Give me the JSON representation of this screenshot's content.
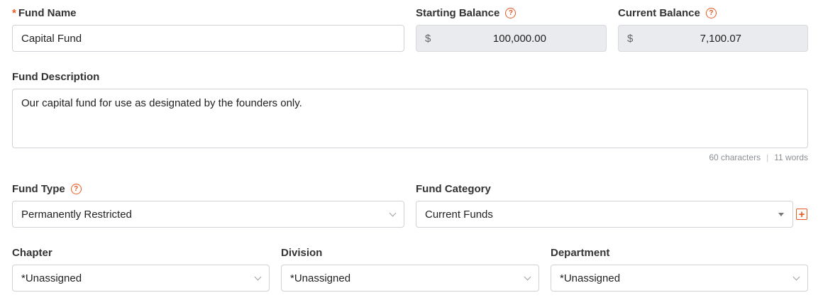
{
  "fund_name": {
    "label": "Fund Name",
    "required_mark": "*",
    "value": "Capital Fund"
  },
  "starting_balance": {
    "label": "Starting Balance",
    "currency": "$",
    "value": "100,000.00"
  },
  "current_balance": {
    "label": "Current Balance",
    "currency": "$",
    "value": "7,100.07"
  },
  "fund_description": {
    "label": "Fund Description",
    "value": "Our capital fund for use as designated by the founders only.",
    "char_count": "60 characters",
    "word_count": "11 words"
  },
  "fund_type": {
    "label": "Fund Type",
    "value": "Permanently Restricted"
  },
  "fund_category": {
    "label": "Fund Category",
    "value": "Current Funds"
  },
  "chapter": {
    "label": "Chapter",
    "value": "*Unassigned"
  },
  "division": {
    "label": "Division",
    "value": "*Unassigned"
  },
  "department": {
    "label": "Department",
    "value": "*Unassigned"
  },
  "icons": {
    "help": "?",
    "add": "+"
  },
  "colors": {
    "accent": "#e8591f",
    "readonly_bg": "#e9ebee",
    "border": "#cfd3d7"
  }
}
